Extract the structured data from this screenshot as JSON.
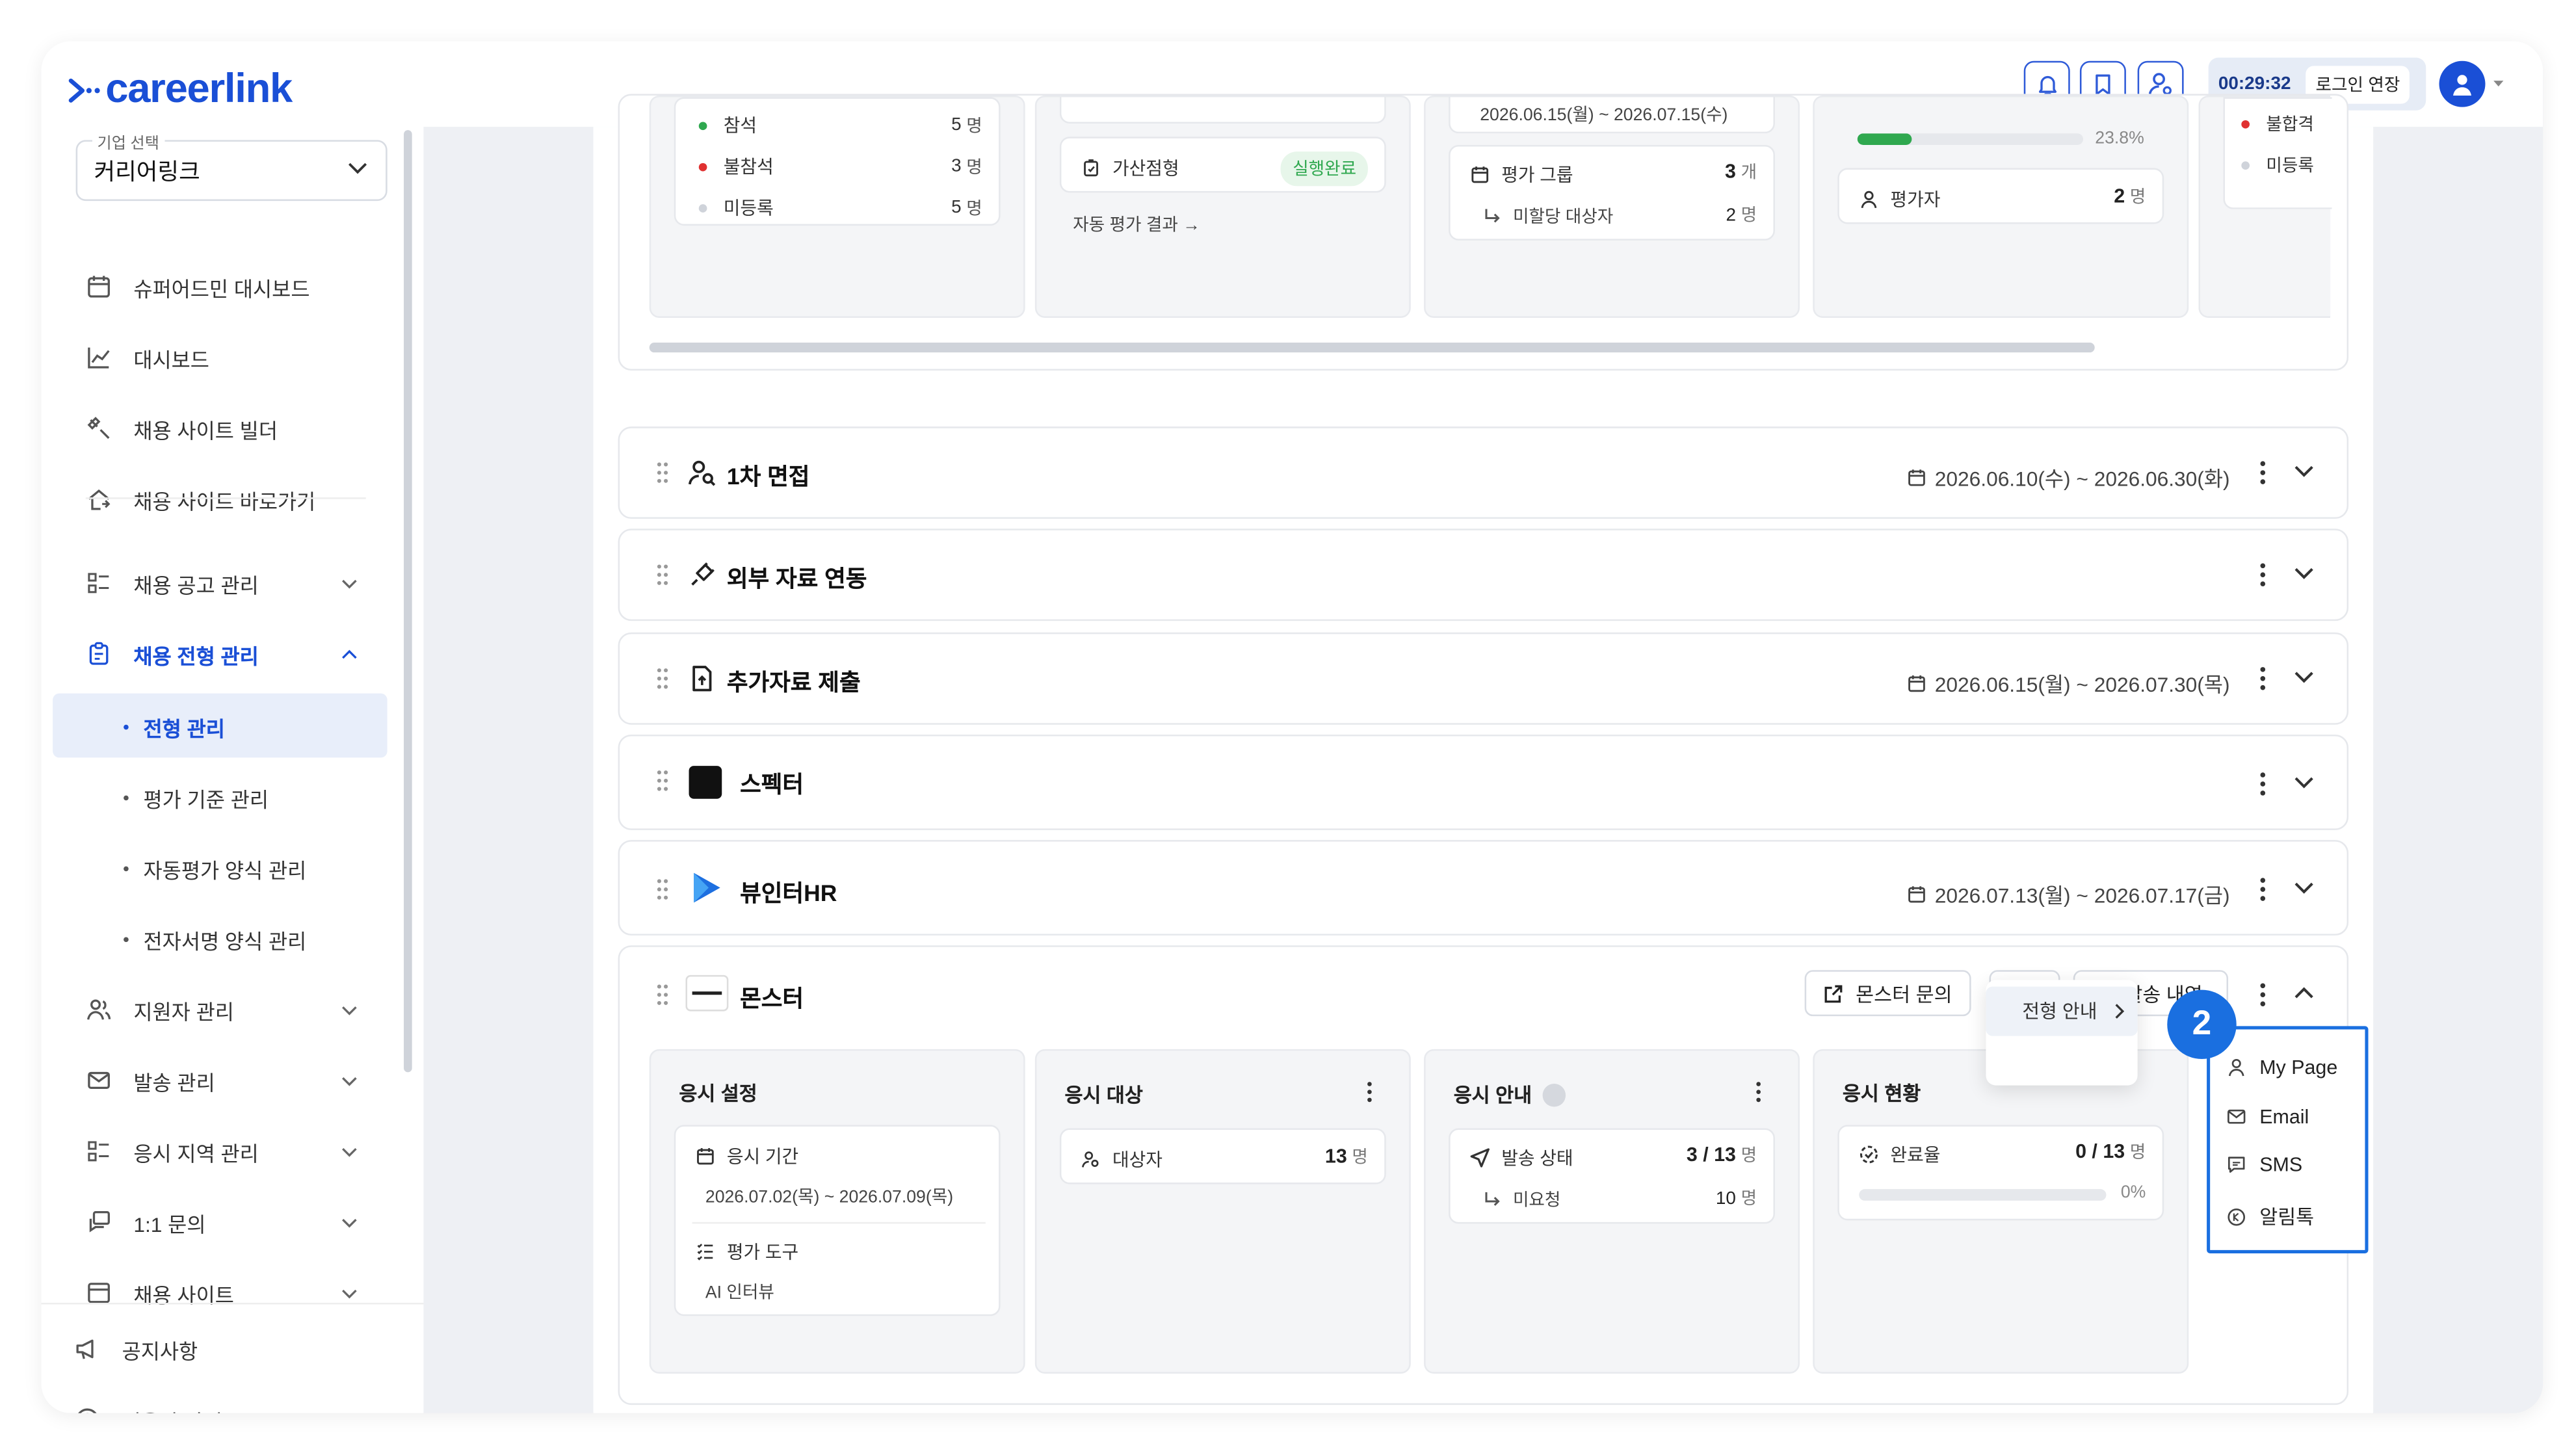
{
  "app": {
    "logo_text": "careerlink"
  },
  "topbar": {
    "icons": [
      "bell-icon",
      "bookmark-icon",
      "user-settings-icon"
    ],
    "timer": "00:29:32",
    "extend_label": "로그인 연장",
    "accent": "#1a4fd6"
  },
  "sidebar": {
    "company_label": "기업 선택",
    "company_value": "커리어링크",
    "items": [
      {
        "label": "슈퍼어드민 대시보드",
        "icon": "calendar-icon"
      },
      {
        "label": "대시보드",
        "icon": "chart-icon"
      },
      {
        "label": "채용 사이트 빌더",
        "icon": "tools-icon"
      },
      {
        "label": "채용 사이트 바로가기",
        "icon": "home-link-icon"
      },
      {
        "label": "채용 공고 관리",
        "icon": "list-icon"
      },
      {
        "label": "채용 전형 관리",
        "icon": "clipboard-icon"
      },
      {
        "label": "지원자 관리",
        "icon": "users-icon"
      },
      {
        "label": "발송 관리",
        "icon": "mail-icon"
      },
      {
        "label": "응시 지역 관리",
        "icon": "list-icon"
      },
      {
        "label": "1:1 문의",
        "icon": "chat-icon"
      },
      {
        "label": "채용 사이트",
        "icon": "window-icon"
      }
    ],
    "sub_items": [
      "전형 관리",
      "평가 기준 관리",
      "자동평가 양식 관리",
      "전자서명 양식 관리"
    ],
    "footer": [
      "공지사항",
      "이용자 가이드"
    ]
  },
  "top_section": {
    "attendance": [
      {
        "label": "참석",
        "value": "5",
        "unit": "명",
        "color": "#2fa84f"
      },
      {
        "label": "불참석",
        "value": "3",
        "unit": "명",
        "color": "#e03131"
      },
      {
        "label": "미등록",
        "value": "5",
        "unit": "명",
        "color": "#cfd3da"
      }
    ],
    "scoring_label": "가산점형",
    "scoring_status": "실행완료",
    "auto_result_link": "자동 평가 결과 →",
    "eval_period": "2026.06.15(월) ~ 2026.07.15(수)",
    "eval_group_label": "평가 그룹",
    "eval_group_value": "3",
    "eval_group_unit": "개",
    "unassigned_label": "미할당 대상자",
    "unassigned_value": "2",
    "unassigned_unit": "명",
    "progress_pct": "23.8%",
    "progress_value": 0.238,
    "evaluator_label": "평가자",
    "evaluator_value": "2",
    "evaluator_unit": "명",
    "right_labels": [
      "불합격",
      "미등록"
    ]
  },
  "stages": [
    {
      "title": "1차 면접",
      "icon": "person-search-icon",
      "date": "2026.06.10(수) ~ 2026.06.30(화)"
    },
    {
      "title": "외부 자료 연동",
      "icon": "plug-icon",
      "date": ""
    },
    {
      "title": "추가자료 제출",
      "icon": "file-upload-icon",
      "date": "2026.06.15(월) ~ 2026.07.30(목)"
    },
    {
      "title": "스펙터",
      "icon": "spector-logo-icon",
      "date": ""
    },
    {
      "title": "뷰인터HR",
      "icon": "viewinter-logo-icon",
      "date": "2026.07.13(월) ~ 2026.07.17(금)"
    }
  ],
  "monster": {
    "title": "몬스터",
    "inquiry_button": "몬스터 문의",
    "history_button": "발송 내역",
    "exam_settings": {
      "title": "응시 설정",
      "period_label": "응시 기간",
      "period_value": "2026.07.02(목) ~ 2026.07.09(목)",
      "tool_label": "평가 도구",
      "tool_value": "AI 인터뷰"
    },
    "exam_target": {
      "title": "응시 대상",
      "label": "대상자",
      "value": "13",
      "unit": "명"
    },
    "exam_notice": {
      "title": "응시 안내",
      "status_label": "발송 상태",
      "status_value": "3 / 13",
      "status_unit": "명",
      "pending_label": "미요청",
      "pending_value": "10",
      "pending_unit": "명"
    },
    "exam_status": {
      "title": "응시 현황",
      "rate_label": "완료율",
      "rate_value": "0 / 13",
      "rate_unit": "명",
      "rate_pct": "0%",
      "progress_value": 0
    }
  },
  "dropdown": {
    "parent_item": "전형 안내",
    "badge": "2",
    "items": [
      {
        "label": "My Page",
        "icon": "user-icon"
      },
      {
        "label": "Email",
        "icon": "mail-icon"
      },
      {
        "label": "SMS",
        "icon": "message-icon"
      },
      {
        "label": "알림톡",
        "icon": "kakao-chat-icon"
      }
    ],
    "highlight_color": "#1a6fe0"
  }
}
